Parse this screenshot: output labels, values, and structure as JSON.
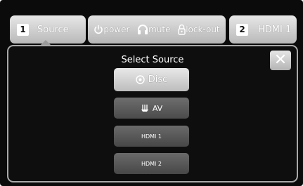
{
  "tabs": {
    "source": {
      "number": "1",
      "label": "Source"
    },
    "hdmi": {
      "number": "2",
      "label": "HDMI 1"
    }
  },
  "controls": {
    "power": {
      "label": "power",
      "icon": "power-icon"
    },
    "mute": {
      "label": "mute",
      "icon": "headphones-icon"
    },
    "lockout": {
      "label": "lock-out",
      "icon": "lock-icon"
    }
  },
  "panel": {
    "title": "Select Source",
    "close_icon": "close-icon",
    "sources": [
      {
        "label": "Disc",
        "icon": "disc-icon",
        "selected": true
      },
      {
        "label": "AV",
        "icon": "av-jack-icon",
        "selected": false
      },
      {
        "label": "HDMI 1",
        "selected": false
      },
      {
        "label": "HDMI 2",
        "selected": false
      }
    ]
  },
  "colors": {
    "background": "#0b0b0b",
    "button_light": "#d0d0d0",
    "button_dark": "#5a5a5a",
    "text": "#ffffff"
  }
}
